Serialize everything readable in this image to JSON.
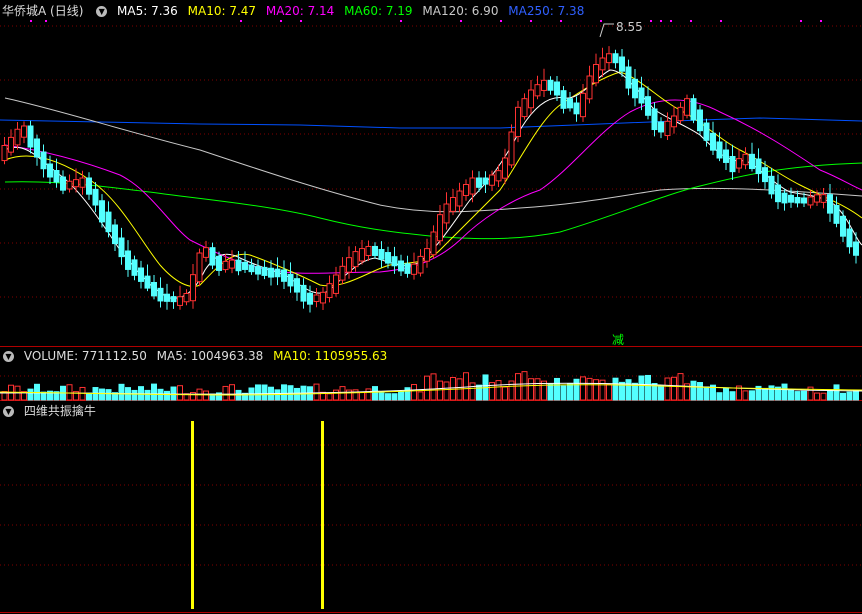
{
  "main_panel": {
    "title": "华侨城A (日线)",
    "indicators": [
      {
        "label": "MA5: 7.36",
        "color": "#ffffff"
      },
      {
        "label": "MA10: 7.47",
        "color": "#ffff00"
      },
      {
        "label": "MA20: 7.14",
        "color": "#ff00ff"
      },
      {
        "label": "MA60: 7.19",
        "color": "#00ff00"
      },
      {
        "label": "MA120: 6.90",
        "color": "#c8c8c8"
      },
      {
        "label": "MA250: 7.38",
        "color": "#0050ff"
      }
    ],
    "high_label": "8.55",
    "signal_label": "减"
  },
  "volume_panel": {
    "label": "VOLUME: 771112.50",
    "ma5": "MA5: 1004963.38",
    "ma10": "MA10: 1105955.63"
  },
  "indicator_panel": {
    "title": "四维共振擒牛"
  },
  "colors": {
    "up": "#ff3232",
    "down": "#54ffff",
    "grid": "#800000",
    "signal": "#ffff00"
  }
}
